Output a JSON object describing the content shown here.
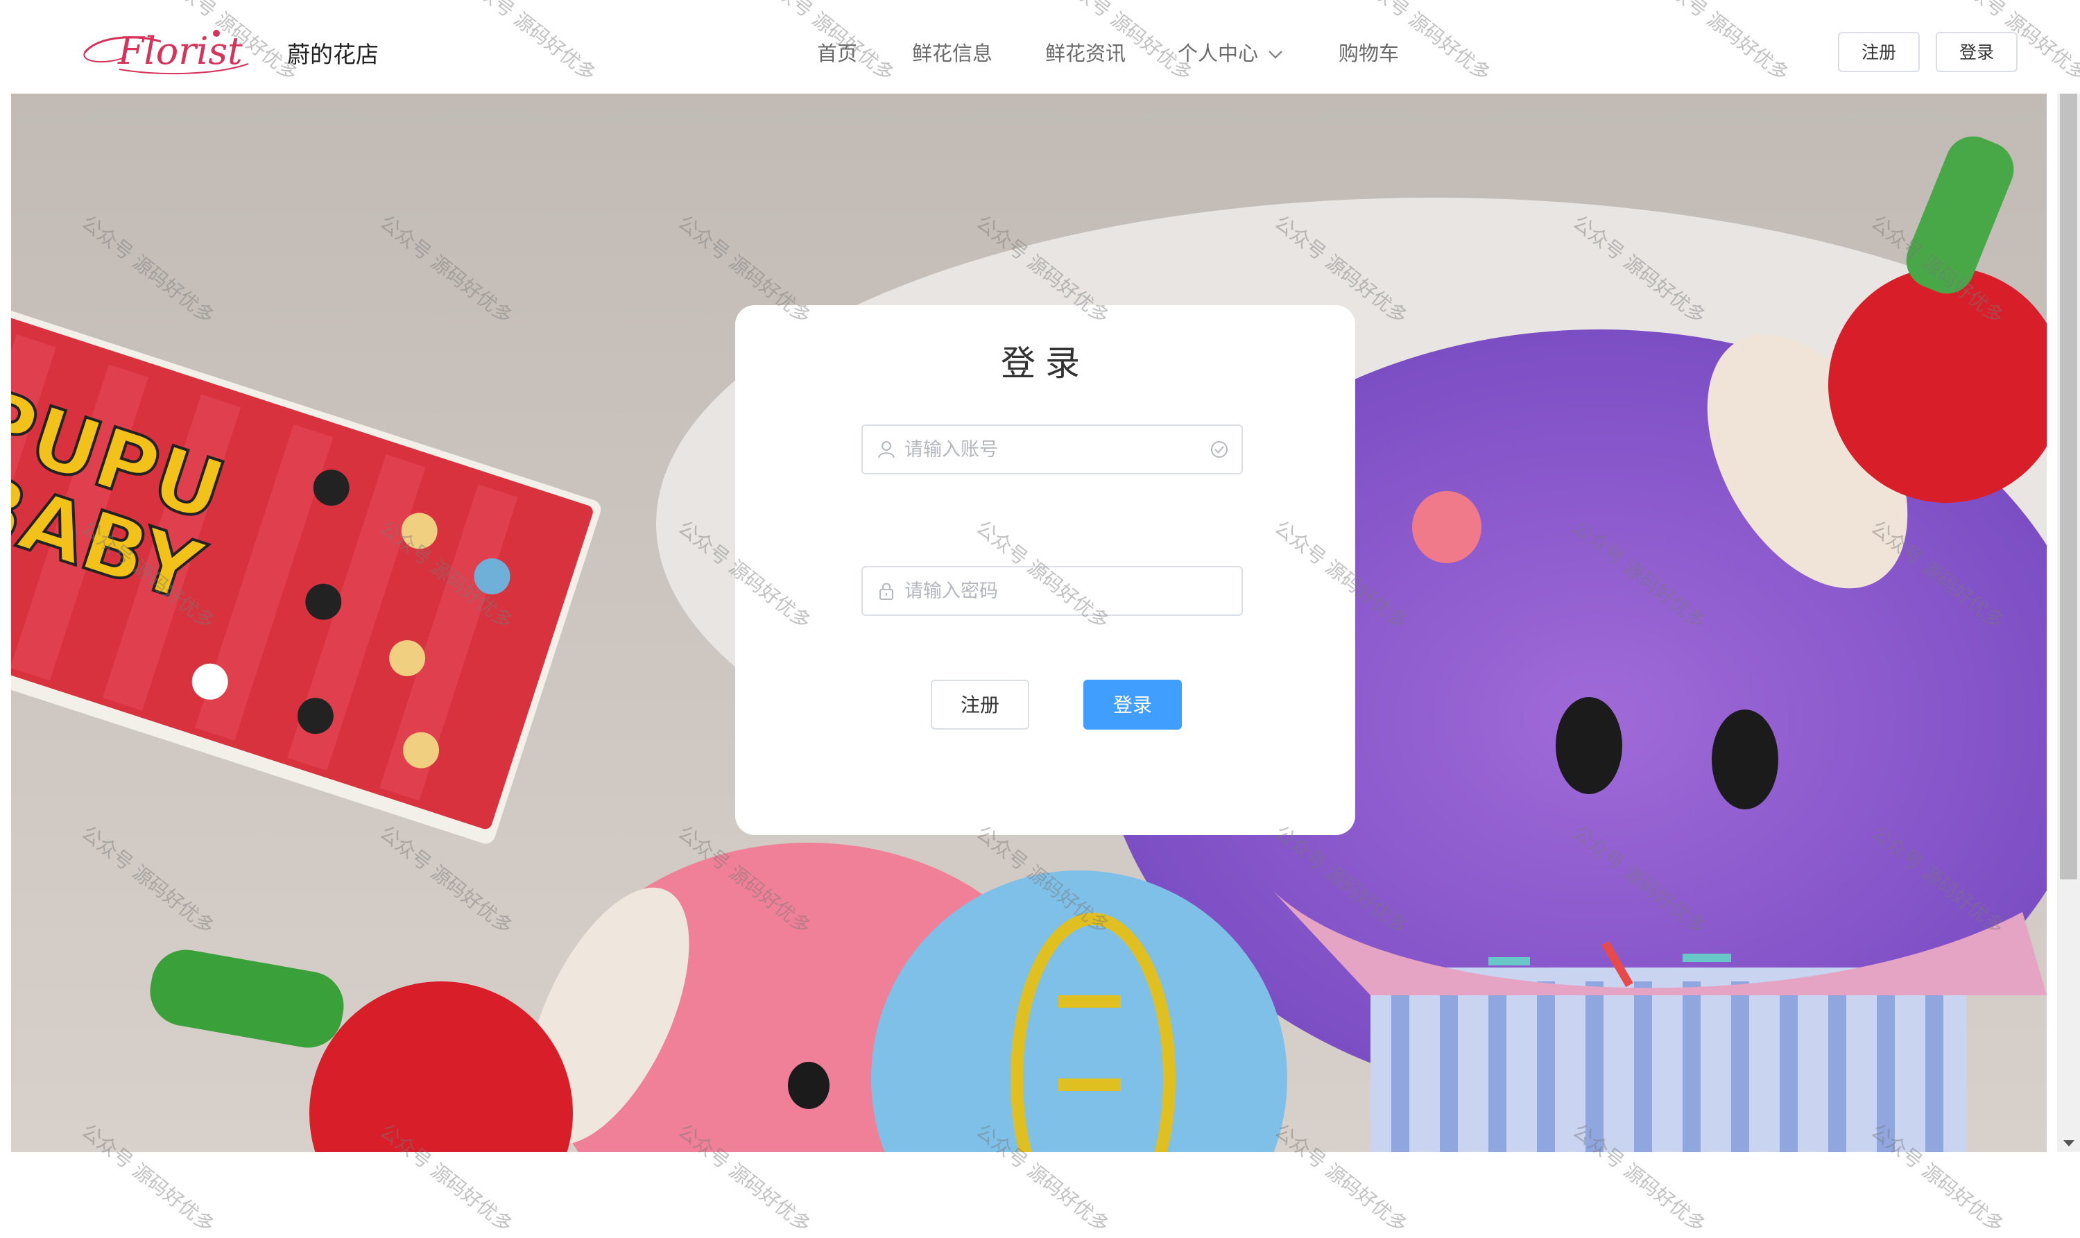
{
  "header": {
    "logo_text": "Florist",
    "site_name": "蔚的花店",
    "nav": [
      {
        "label": "首页"
      },
      {
        "label": "鲜花信息"
      },
      {
        "label": "鲜花资讯"
      },
      {
        "label": "个人中心"
      },
      {
        "label": "购物车"
      }
    ],
    "register_label": "注册",
    "login_label": "登录"
  },
  "login_card": {
    "title": "登录",
    "username_placeholder": "请输入账号",
    "password_placeholder": "请输入密码",
    "register_label": "注册",
    "login_label": "登录"
  },
  "watermark_text": "公众号 源码好优多",
  "colors": {
    "primary": "#409eff",
    "logo": "#d6325a",
    "nav_text": "#6a6a6a"
  },
  "icons": [
    "user-icon",
    "check-circle-icon",
    "lock-icon",
    "chevron-down-icon"
  ]
}
